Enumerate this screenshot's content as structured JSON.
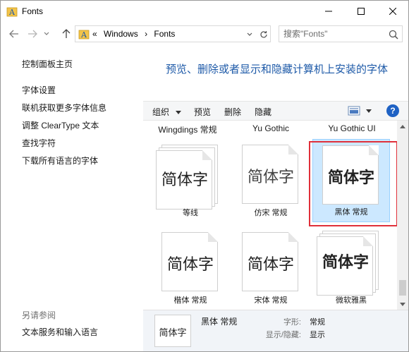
{
  "window": {
    "title": "Fonts",
    "app_icon": "fonts-folder-icon"
  },
  "address": {
    "chevron": "«",
    "crumbs": [
      "Windows",
      "Fonts"
    ],
    "search_placeholder": "搜索\"Fonts\""
  },
  "leftnav": {
    "home": "控制面板主页",
    "items": [
      "字体设置",
      "联机获取更多字体信息",
      "调整 ClearType 文本",
      "查找字符",
      "下载所有语言的字体"
    ],
    "see_also_title": "另请参阅",
    "see_also_items": [
      "文本服务和输入语言"
    ]
  },
  "heading": "预览、删除或者显示和隐藏计算机上安装的字体",
  "toolbar": {
    "organize": "组织",
    "preview": "预览",
    "delete": "删除",
    "hide": "隐藏",
    "help": "?"
  },
  "top_labels": [
    "Wingdings 常规",
    "Yu Gothic",
    "Yu Gothic UI"
  ],
  "fonts": [
    {
      "name": "等线",
      "sample": "简体字",
      "selected": false
    },
    {
      "name": "仿宋 常规",
      "sample": "简体字",
      "selected": false
    },
    {
      "name": "黑体 常规",
      "sample": "简体字",
      "selected": true
    },
    {
      "name": "楷体 常规",
      "sample": "简体字",
      "selected": false
    },
    {
      "name": "宋体 常规",
      "sample": "简体字",
      "selected": false
    },
    {
      "name": "微软雅黑",
      "sample": "简体字",
      "selected": false
    }
  ],
  "details": {
    "thumb_sample": "简体字",
    "name": "黑体 常规",
    "style_label": "字形:",
    "style_value": "常规",
    "visibility_label": "显示/隐藏:",
    "visibility_value": "显示"
  },
  "colors": {
    "accent": "#1e5aa8",
    "selection": "#cce8ff",
    "highlight": "#e0303a"
  }
}
